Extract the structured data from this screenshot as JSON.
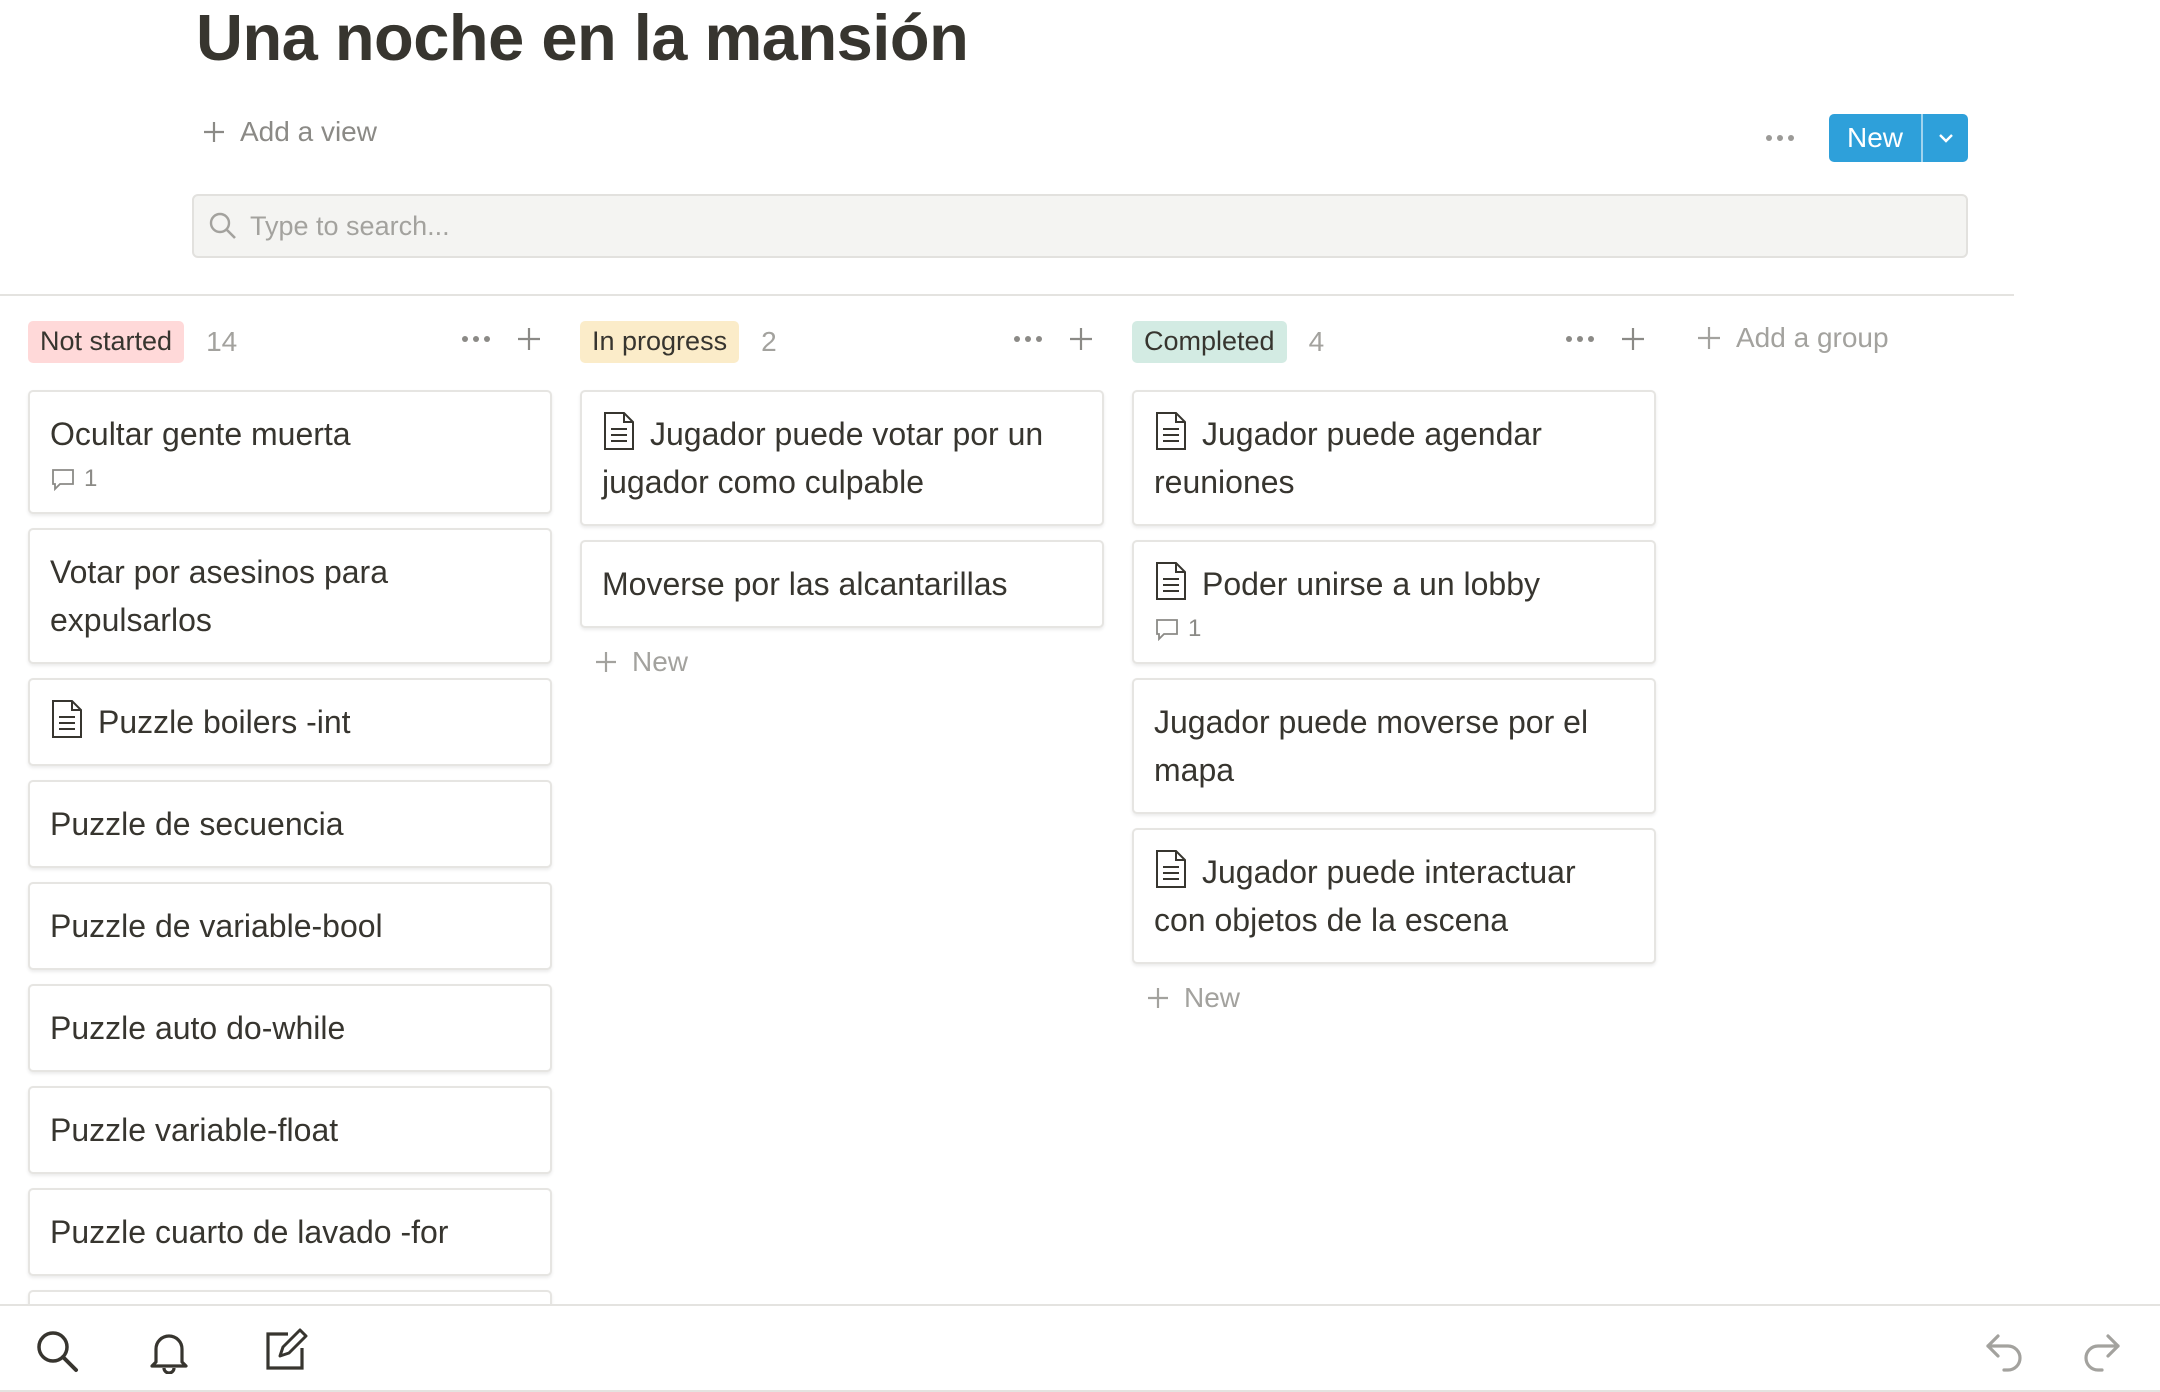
{
  "page": {
    "title": "Una noche en la mansión"
  },
  "toolbar": {
    "add_view_label": "Add a view",
    "new_label": "New"
  },
  "search": {
    "placeholder": "Type to search..."
  },
  "columns": [
    {
      "name": "Not started",
      "count": "14",
      "badge_bg": "#ffd9d9",
      "cards": [
        {
          "title": "Ocultar gente muerta",
          "doc": false,
          "comments": "1"
        },
        {
          "title": "Votar por asesinos para expulsarlos",
          "doc": false
        },
        {
          "title": "Puzzle boilers -int",
          "doc": true
        },
        {
          "title": "Puzzle de secuencia",
          "doc": false
        },
        {
          "title": "Puzzle de variable-bool",
          "doc": false
        },
        {
          "title": "Puzzle auto do-while",
          "doc": false
        },
        {
          "title": "Puzzle variable-float",
          "doc": false
        },
        {
          "title": "Puzzle cuarto de lavado -for",
          "doc": false
        }
      ]
    },
    {
      "name": "In progress",
      "count": "2",
      "badge_bg": "#fbecc9",
      "cards": [
        {
          "title": "Jugador puede votar por un jugador como culpable",
          "doc": true
        },
        {
          "title": "Moverse por las alcantarillas",
          "doc": false
        }
      ],
      "new_label": "New"
    },
    {
      "name": "Completed",
      "count": "4",
      "badge_bg": "#d3ebe3",
      "cards": [
        {
          "title": "Jugador puede agendar reuniones",
          "doc": true
        },
        {
          "title": "Poder unirse a un lobby",
          "doc": true,
          "comments": "1"
        },
        {
          "title": "Jugador puede moverse por el mapa",
          "doc": false
        },
        {
          "title": "Jugador puede interactuar con objetos de la escena",
          "doc": true
        }
      ],
      "new_label": "New"
    }
  ],
  "add_group_label": "Add a group",
  "colors": {
    "accent": "#2ea0da",
    "text": "#37352f",
    "muted": "#a3a29e"
  },
  "bottom_bar": {
    "icons": [
      "search-icon",
      "bell-icon",
      "compose-icon",
      "undo-icon",
      "redo-icon"
    ]
  }
}
